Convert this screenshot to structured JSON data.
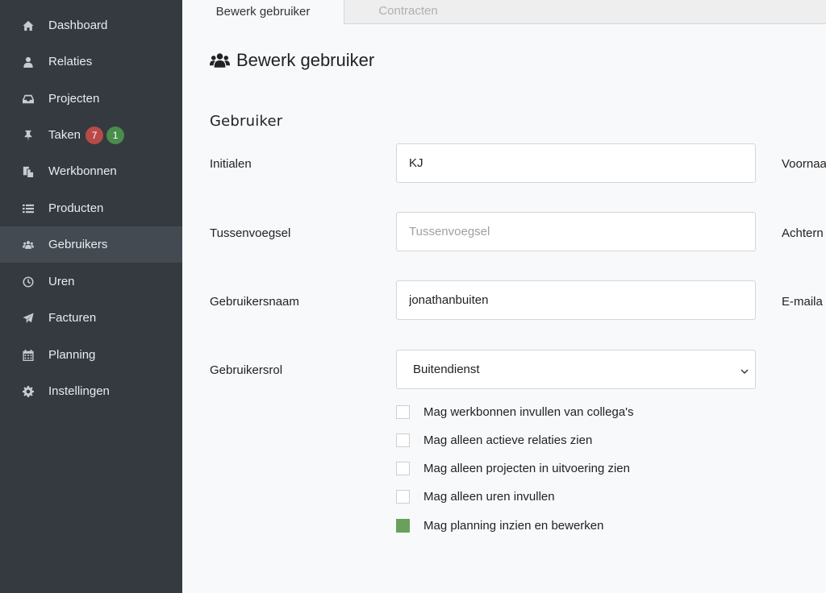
{
  "sidebar": {
    "items": [
      {
        "label": "Dashboard",
        "icon": "home-icon"
      },
      {
        "label": "Relaties",
        "icon": "user-icon"
      },
      {
        "label": "Projecten",
        "icon": "inbox-icon"
      },
      {
        "label": "Taken",
        "icon": "pin-icon",
        "badges": [
          "7",
          "1"
        ]
      },
      {
        "label": "Werkbonnen",
        "icon": "copy-icon"
      },
      {
        "label": "Producten",
        "icon": "list-icon"
      },
      {
        "label": "Gebruikers",
        "icon": "users-icon",
        "active": true
      },
      {
        "label": "Uren",
        "icon": "clock-icon"
      },
      {
        "label": "Facturen",
        "icon": "paper-plane-icon"
      },
      {
        "label": "Planning",
        "icon": "calendar-icon"
      },
      {
        "label": "Instellingen",
        "icon": "gear-icon"
      }
    ]
  },
  "tabs": [
    {
      "label": "Bewerk gebruiker",
      "active": true
    },
    {
      "label": "Contracten",
      "active": false
    }
  ],
  "page": {
    "title": "Bewerk gebruiker",
    "section_title": "Gebruiker"
  },
  "form": {
    "initialen": {
      "label": "Initialen",
      "value": "KJ"
    },
    "tussenvoegsel": {
      "label": "Tussenvoegsel",
      "value": "",
      "placeholder": "Tussenvoegsel"
    },
    "gebruikersnaam": {
      "label": "Gebruikersnaam",
      "value": "jonathanbuiten"
    },
    "gebruikersrol": {
      "label": "Gebruikersrol",
      "value": "Buitendienst"
    },
    "right_labels": [
      "Voornaa",
      "Achtern",
      "E-maila"
    ],
    "checkboxes": [
      {
        "label": "Mag werkbonnen invullen van collega's",
        "checked": false
      },
      {
        "label": "Mag alleen actieve relaties zien",
        "checked": false
      },
      {
        "label": "Mag alleen projecten in uitvoering zien",
        "checked": false
      },
      {
        "label": "Mag alleen uren invullen",
        "checked": false
      },
      {
        "label": "Mag planning inzien en bewerken",
        "checked": true
      }
    ]
  },
  "colors": {
    "sidebar_bg": "#343a40",
    "sidebar_active": "#434a51",
    "badge_red": "#b84a47",
    "badge_green": "#4a8c4c",
    "checkbox_checked": "#6aa15a"
  }
}
